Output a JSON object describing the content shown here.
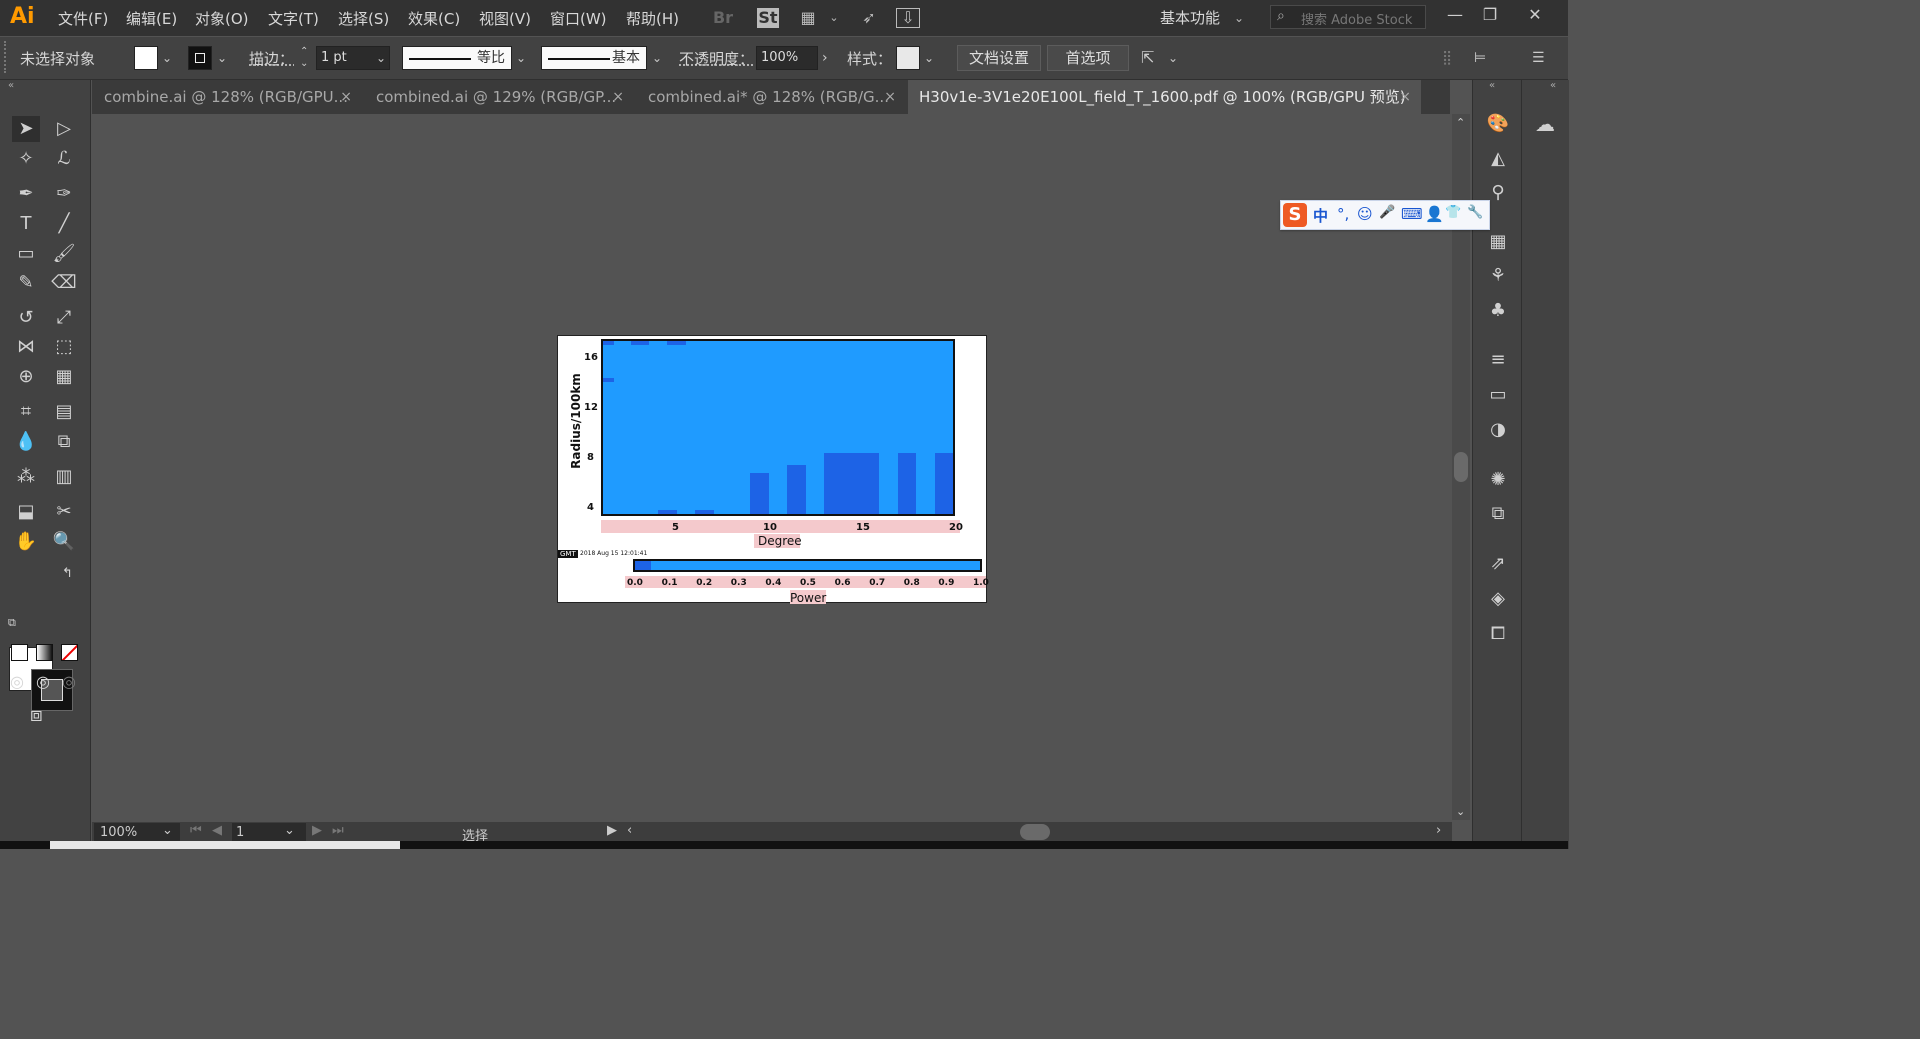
{
  "app": {
    "logo": "Ai",
    "workspace": "基本功能",
    "search_placeholder": "搜索 Adobe Stock"
  },
  "menu": [
    "文件(F)",
    "编辑(E)",
    "对象(O)",
    "文字(T)",
    "选择(S)",
    "效果(C)",
    "视图(V)",
    "窗口(W)",
    "帮助(H)"
  ],
  "menu_icons": [
    "br-icon",
    "st-icon",
    "arrange-documents-icon",
    "gpu-rocket-icon",
    "publish-icon"
  ],
  "control": {
    "selection_label": "未选择对象",
    "stroke_label": "描边：",
    "stroke_weight": "1 pt",
    "profile_label": "等比",
    "brush_label": "基本",
    "opacity_label": "不透明度：",
    "opacity_value": "100%",
    "style_label": "样式：",
    "doc_setup": "文档设置",
    "preferences": "首选项"
  },
  "tabs": [
    {
      "label": "combine.ai @ 128% (RGB/GPU...",
      "close": "×"
    },
    {
      "label": "combined.ai @ 129% (RGB/GP...",
      "close": "×"
    },
    {
      "label": "combined.ai* @ 128% (RGB/G...",
      "close": "×"
    },
    {
      "label": "H30v1e-3V1e20E100L_field_T_1600.pdf @ 100% (RGB/GPU 预览)",
      "close": "×"
    }
  ],
  "status": {
    "zoom": "100%",
    "page": "1",
    "mode": "选择"
  },
  "colors": {
    "plot_fill": "#1f9bff",
    "cell_dark": "#1d63e6",
    "band": "#f4c9cc",
    "ai_orange": "#ff9a00"
  },
  "chart_data": {
    "type": "heatmap",
    "xlabel": "Degree",
    "ylabel": "Radius/100km",
    "x_ticks": [
      "5",
      "10",
      "15",
      "20"
    ],
    "y_ticks": [
      "16",
      "12",
      "8",
      "4"
    ],
    "colorbar_label": "Power",
    "colorbar_ticks": [
      "0.0",
      "0.1",
      "0.2",
      "0.3",
      "0.4",
      "0.5",
      "0.6",
      "0.7",
      "0.8",
      "0.9",
      "1.0"
    ],
    "gmt_badge": "GMT",
    "timestamp": "2018 Aug 15 12:01:41",
    "xlim": [
      1,
      20
    ],
    "ylim": [
      3.5,
      17.5
    ],
    "dark_cells": [
      {
        "x": [
          9,
          10
        ],
        "y": [
          3.5,
          6.8
        ],
        "power": 0.05
      },
      {
        "x": [
          11,
          12
        ],
        "y": [
          3.5,
          7.5
        ],
        "power": 0.05
      },
      {
        "x": [
          13,
          16
        ],
        "y": [
          3.5,
          8.4
        ],
        "power": 0.05
      },
      {
        "x": [
          17,
          18
        ],
        "y": [
          3.5,
          8.4
        ],
        "power": 0.05
      },
      {
        "x": [
          19,
          20
        ],
        "y": [
          3.5,
          8.4
        ],
        "power": 0.05
      },
      {
        "x": [
          4,
          5
        ],
        "y": [
          3.5,
          3.8
        ],
        "power": 0.05
      },
      {
        "x": [
          6,
          7
        ],
        "y": [
          3.5,
          3.8
        ],
        "power": 0.05
      },
      {
        "x": [
          1,
          1.6
        ],
        "y": [
          14.2,
          14.5
        ],
        "power": 0.05
      },
      {
        "x": [
          1,
          1.6
        ],
        "y": [
          17.2,
          17.5
        ],
        "power": 0.05
      },
      {
        "x": [
          2.5,
          3.5
        ],
        "y": [
          17.2,
          17.5
        ],
        "power": 0.05
      },
      {
        "x": [
          4.5,
          5.5
        ],
        "y": [
          17.2,
          17.5
        ],
        "power": 0.05
      }
    ]
  },
  "ime": {
    "items": [
      "中",
      "°,",
      "☺",
      "🎤",
      "⌨",
      "👕",
      "🔧"
    ]
  }
}
